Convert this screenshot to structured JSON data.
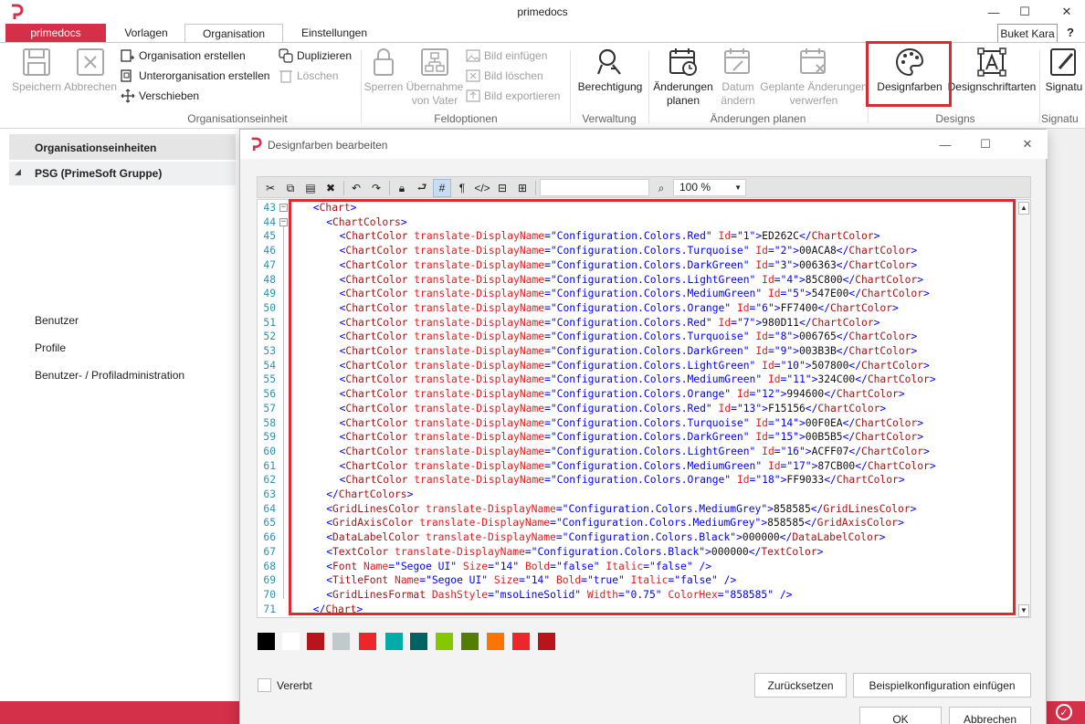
{
  "window": {
    "title": "primedocs"
  },
  "tabs": [
    "primedocs",
    "Vorlagen",
    "Organisation",
    "Einstellungen"
  ],
  "user": {
    "name": "Buket Kara"
  },
  "help": {
    "label": "?"
  },
  "ribbon": {
    "save": "Speichern",
    "cancel": "Abbrechen",
    "create_org": "Organisation erstellen",
    "create_suborg": "Unterorganisation erstellen",
    "move": "Verschieben",
    "duplicate": "Duplizieren",
    "delete": "Löschen",
    "group_org": "Organisationseinheit",
    "lock": "Sperren",
    "inherit_1": "Übernahme",
    "inherit_2": "von Vater",
    "img_insert": "Bild einfügen",
    "img_delete": "Bild löschen",
    "img_export": "Bild exportieren",
    "group_field": "Feldoptionen",
    "permission": "Berechtigung",
    "group_admin": "Verwaltung",
    "plan_1": "Änderungen",
    "plan_2": "planen",
    "date_1": "Datum",
    "date_2": "ändern",
    "discard_1": "Geplante Änderungen",
    "discard_2": "verwerfen",
    "group_plan": "Änderungen planen",
    "design_colors": "Designfarben",
    "design_fonts": "Designschriftarten",
    "signature": "Signatu",
    "group_designs": "Designs",
    "group_sign": "Signatu"
  },
  "left_panel": {
    "header": "Organisationseinheiten",
    "root": "PSG (PrimeSoft Gruppe)",
    "users": "Benutzer",
    "profiles": "Profile",
    "admin": "Benutzer- / Profiladministration"
  },
  "dialog": {
    "title": "Designfarben bearbeiten",
    "zoom": "100 %",
    "inherited": "Vererbt",
    "reset": "Zurücksetzen",
    "insert_sample": "Beispielkonfiguration einfügen",
    "ok": "OK",
    "cancel": "Abbrechen"
  },
  "chart_colors": [
    {
      "id": "1",
      "name": "Configuration.Colors.Red",
      "hex": "ED262C"
    },
    {
      "id": "2",
      "name": "Configuration.Colors.Turquoise",
      "hex": "00ACA8"
    },
    {
      "id": "3",
      "name": "Configuration.Colors.DarkGreen",
      "hex": "006363"
    },
    {
      "id": "4",
      "name": "Configuration.Colors.LightGreen",
      "hex": "85C800"
    },
    {
      "id": "5",
      "name": "Configuration.Colors.MediumGreen",
      "hex": "547E00"
    },
    {
      "id": "6",
      "name": "Configuration.Colors.Orange",
      "hex": "FF7400"
    },
    {
      "id": "7",
      "name": "Configuration.Colors.Red",
      "hex": "980D11"
    },
    {
      "id": "8",
      "name": "Configuration.Colors.Turquoise",
      "hex": "006765"
    },
    {
      "id": "9",
      "name": "Configuration.Colors.DarkGreen",
      "hex": "003B3B"
    },
    {
      "id": "10",
      "name": "Configuration.Colors.LightGreen",
      "hex": "507800"
    },
    {
      "id": "11",
      "name": "Configuration.Colors.MediumGreen",
      "hex": "324C00"
    },
    {
      "id": "12",
      "name": "Configuration.Colors.Orange",
      "hex": "994600"
    },
    {
      "id": "13",
      "name": "Configuration.Colors.Red",
      "hex": "F15156"
    },
    {
      "id": "14",
      "name": "Configuration.Colors.Turquoise",
      "hex": "00F0EA"
    },
    {
      "id": "15",
      "name": "Configuration.Colors.DarkGreen",
      "hex": "00B5B5"
    },
    {
      "id": "16",
      "name": "Configuration.Colors.LightGreen",
      "hex": "ACFF07"
    },
    {
      "id": "17",
      "name": "Configuration.Colors.MediumGreen",
      "hex": "87CB00"
    },
    {
      "id": "18",
      "name": "Configuration.Colors.Orange",
      "hex": "FF9033"
    }
  ],
  "code": {
    "chart_open": "<Chart>",
    "chartcolors_open": "<ChartColors>",
    "chartcolors_close": "</ChartColors>",
    "gridlines": {
      "tag": "GridLinesColor",
      "name": "Configuration.Colors.MediumGrey",
      "value": "858585"
    },
    "gridaxis": {
      "tag": "GridAxisColor",
      "name": "Configuration.Colors.MediumGrey",
      "value": "858585"
    },
    "datalabel": {
      "tag": "DataLabelColor",
      "name": "Configuration.Colors.Black",
      "value": "000000"
    },
    "textcolor": {
      "tag": "TextColor",
      "name": "Configuration.Colors.Black",
      "value": "000000"
    },
    "font": {
      "name": "Segoe UI",
      "size": "14",
      "bold": "false",
      "italic": "false"
    },
    "titlefont": {
      "name": "Segoe UI",
      "size": "14",
      "bold": "true",
      "italic": "false"
    },
    "gridlinesformat": {
      "dash": "msoLineSolid",
      "width": "0.75",
      "hex": "858585"
    },
    "chart_close": "</Chart>",
    "first_line": "43"
  },
  "swatches": [
    "#000000",
    "#ffffff",
    "#b8141b",
    "#c2c9cc",
    "#ed262c",
    "#00aca8",
    "#006363",
    "#85c800",
    "#547e00",
    "#ff7400",
    "#ed262c",
    "#b8141b"
  ],
  "brand_color": "#d5304a",
  "highlight_color": "#d92b34"
}
